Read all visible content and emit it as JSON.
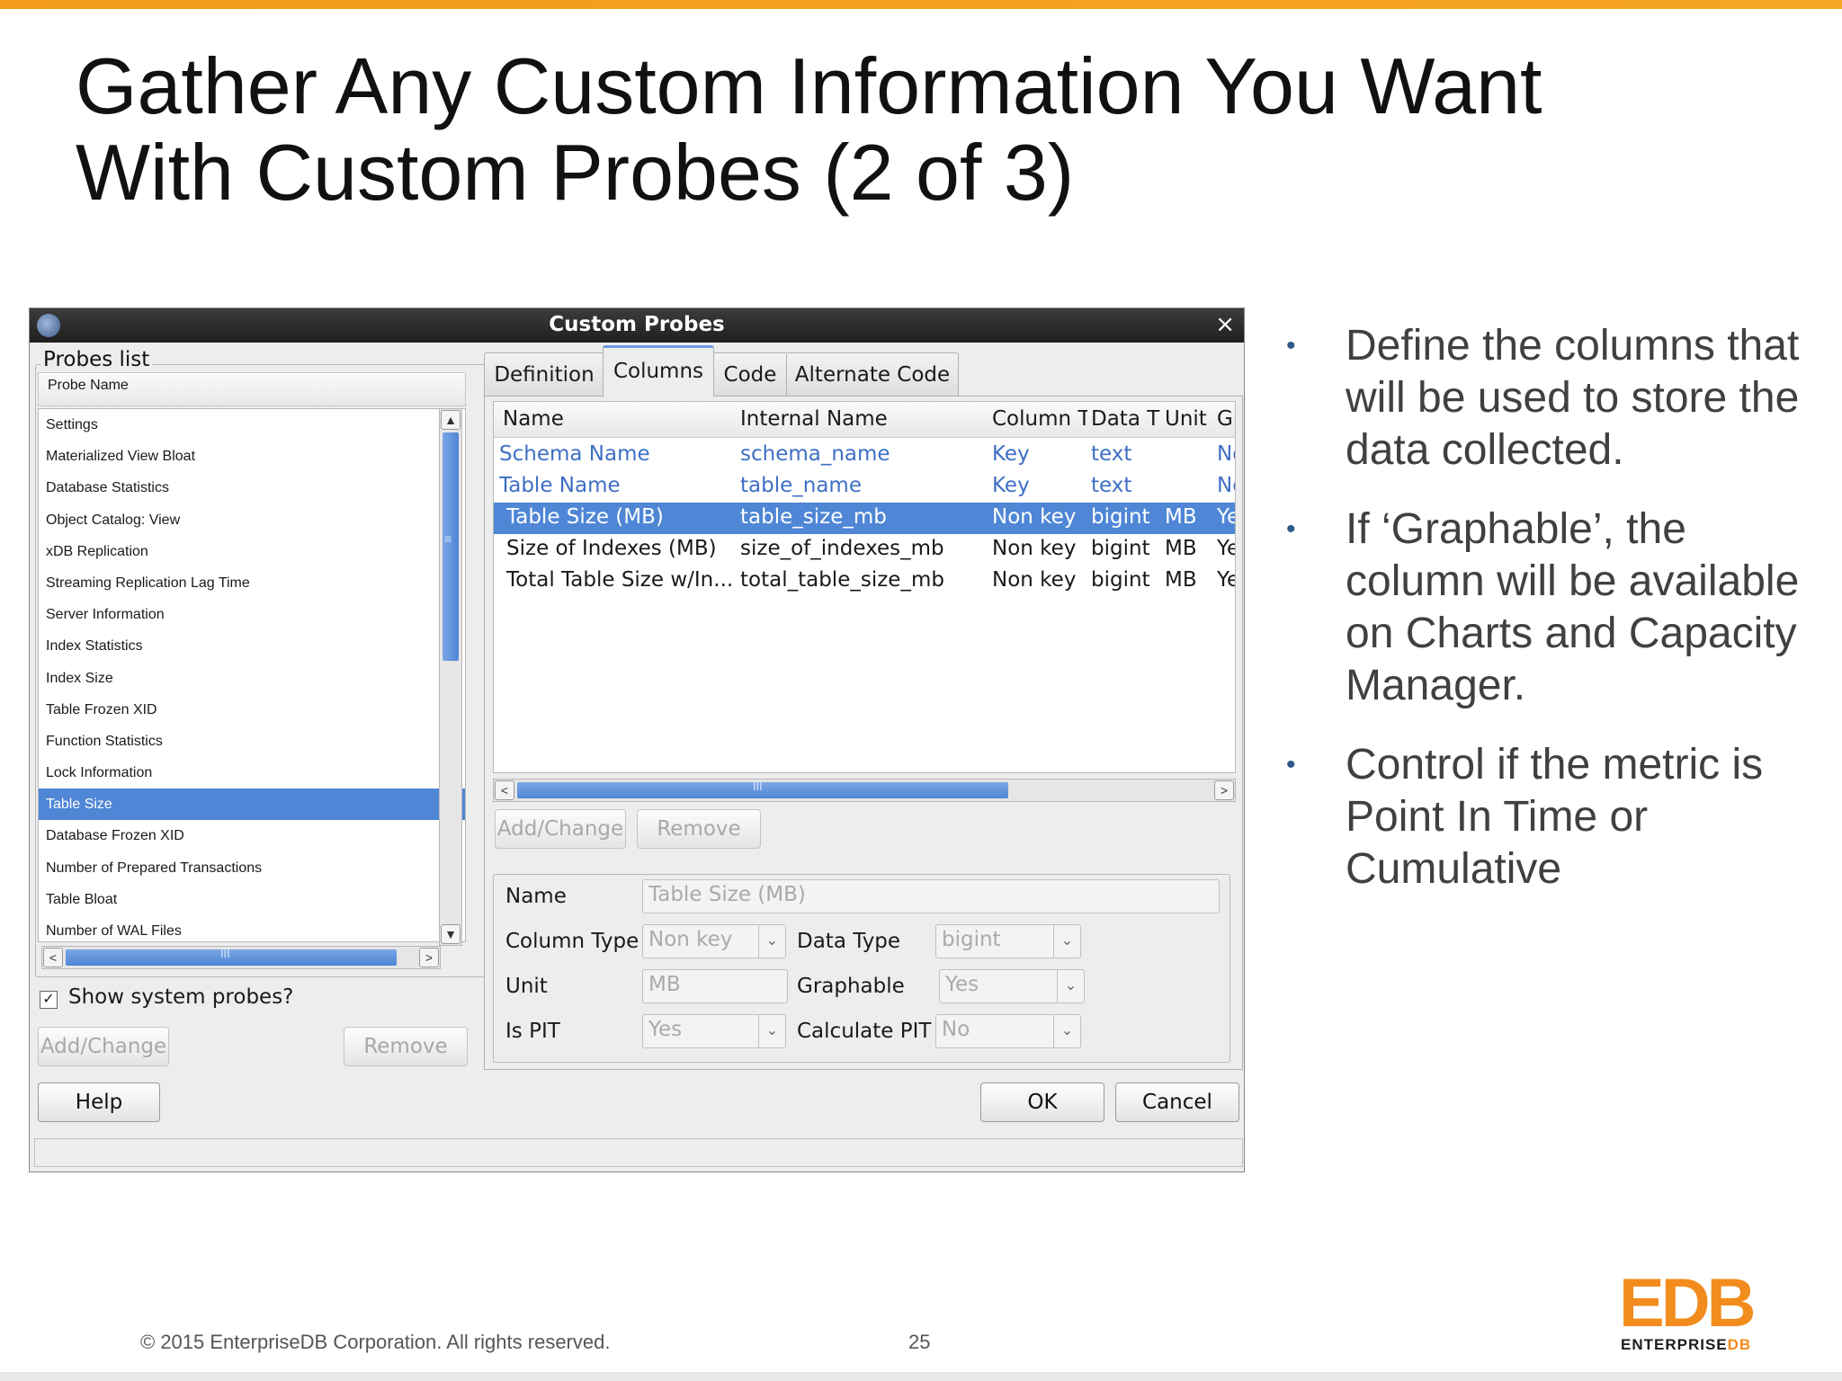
{
  "slide": {
    "title_line1": "Gather Any Custom Information You Want",
    "title_line2": "With Custom Probes (2 of 3)",
    "bullets": [
      "Define the columns that will be used to store the data collected.",
      "If ‘Graphable’, the column will be available on Charts and Capacity Manager.",
      "Control if the metric is Point In Time or Cumulative"
    ],
    "footer_copyright": "© 2015 EnterpriseDB Corporation. All rights reserved.",
    "page_number": "25",
    "logo": {
      "mark": "EDB",
      "sub_prefix": "ENTERPRISE",
      "sub_suffix": "DB"
    }
  },
  "dialog": {
    "title": "Custom Probes",
    "close_symbol": "×",
    "probes_list": {
      "group_label": "Probes list",
      "column_header": "Probe Name",
      "items": [
        "Settings",
        "Materialized View Bloat",
        "Database Statistics",
        "Object Catalog: View",
        "xDB Replication",
        "Streaming Replication Lag Time",
        "Server Information",
        "Index Statistics",
        "Index Size",
        "Table Frozen XID",
        "Function Statistics",
        "Lock Information",
        "Table Size",
        "Database Frozen XID",
        "Number of Prepared Transactions",
        "Table Bloat",
        "Number of WAL Files"
      ],
      "selected_index": 12
    },
    "show_system_probes": {
      "label": "Show system probes?",
      "checked": true,
      "check_symbol": "✓"
    },
    "left_buttons": {
      "add_change": "Add/Change",
      "remove": "Remove"
    },
    "help_button": "Help",
    "tabs": [
      "Definition",
      "Columns",
      "Code",
      "Alternate Code"
    ],
    "active_tab": "Columns",
    "columns_table": {
      "headers": [
        "Name",
        "Internal Name",
        "Column T",
        "Data T",
        "Unit",
        "G"
      ],
      "rows": [
        [
          "Schema Name",
          "schema_name",
          "Key",
          "text",
          "",
          "No"
        ],
        [
          "Table Name",
          "table_name",
          "Key",
          "text",
          "",
          "No"
        ],
        [
          "Table Size (MB)",
          "table_size_mb",
          "Non key",
          "bigint",
          "MB",
          "Yes"
        ],
        [
          "Size of Indexes (MB)",
          "size_of_indexes_mb",
          "Non key",
          "bigint",
          "MB",
          "Yes"
        ],
        [
          "Total Table Size w/In...",
          "total_table_size_mb",
          "Non key",
          "bigint",
          "MB",
          "Yes"
        ]
      ],
      "selected_row": 2,
      "scroll_glyph": "III"
    },
    "tab_buttons": {
      "add_change": "Add/Change",
      "remove": "Remove"
    },
    "form": {
      "name_label": "Name",
      "name_value": "Table Size (MB)",
      "column_type_label": "Column Type",
      "column_type_value": "Non key",
      "data_type_label": "Data Type",
      "data_type_value": "bigint",
      "unit_label": "Unit",
      "unit_value": "MB",
      "graphable_label": "Graphable",
      "graphable_value": "Yes",
      "is_pit_label": "Is PIT",
      "is_pit_value": "Yes",
      "calculate_pit_label": "Calculate PIT",
      "calculate_pit_value": "No"
    },
    "ok_button": "OK",
    "cancel_button": "Cancel",
    "arrows": {
      "up": "▲",
      "down": "▼",
      "left": "<",
      "right": ">",
      "dropdown": "⌄"
    },
    "list_scroll_glyph": "III",
    "vscroll_grip": "≡"
  },
  "colors": {
    "accent_orange": "#f29b1c",
    "selection_blue": "#4f86d6",
    "key_row_blue": "#3d6fc4"
  }
}
